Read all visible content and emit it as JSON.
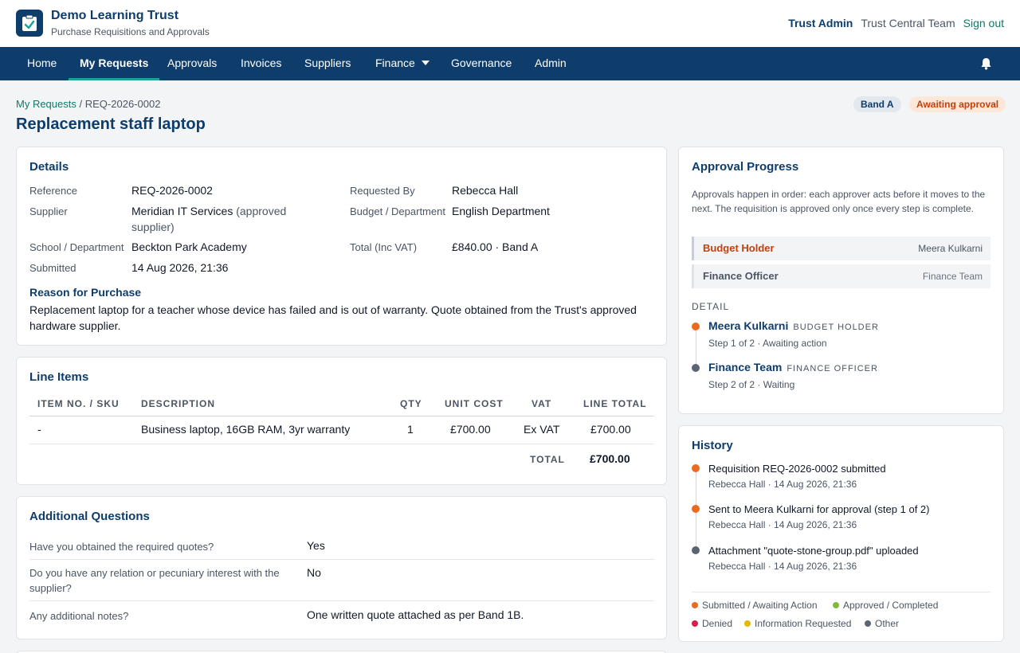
{
  "header": {
    "brand_title": "Demo Learning Trust",
    "brand_subtitle": "Purchase Requisitions and Approvals",
    "user_name": "Trust Admin",
    "user_team": "Trust Central Team",
    "sign_out": "Sign out"
  },
  "nav": {
    "items": [
      "Home",
      "My Requests",
      "Approvals",
      "Invoices",
      "Suppliers",
      "Finance",
      "Governance",
      "Admin"
    ],
    "active": "My Requests",
    "icons": [
      "bell-icon",
      "caret-down-icon"
    ]
  },
  "breadcrumb": {
    "parent": "My Requests",
    "separator": "/",
    "current": "REQ-2026-0002"
  },
  "page_title": "Replacement staff laptop",
  "badges": {
    "band": "Band A",
    "status": "Awaiting approval"
  },
  "colors": {
    "brand": "#0f3d6b",
    "accent": "#0f7a66",
    "orange": "#ea6a1f",
    "green": "#84b83a",
    "red": "#d61f4f",
    "yellow": "#e6b800",
    "grey": "#5b6472"
  },
  "details": {
    "title": "Details",
    "reference_label": "Reference",
    "reference": "REQ-2026-0002",
    "requested_by_label": "Requested By",
    "requested_by": "Rebecca Hall",
    "supplier_label": "Supplier",
    "supplier": "Meridian IT Services",
    "supplier_note": "(approved supplier)",
    "budget_label": "Budget / Department",
    "budget": "English Department",
    "school_label": "School / Department",
    "school": "Beckton Park Academy",
    "total_label": "Total (Inc VAT)",
    "total": "£840.00 · Band A",
    "submitted_label": "Submitted",
    "submitted": "14 Aug 2026, 21:36",
    "reason_title": "Reason for Purchase",
    "reason": "Replacement laptop for a teacher whose device has failed and is out of warranty. Quote obtained from the Trust's approved hardware supplier."
  },
  "line_items": {
    "title": "Line Items",
    "headers": [
      "ITEM NO. / SKU",
      "DESCRIPTION",
      "QTY",
      "UNIT COST",
      "VAT",
      "LINE TOTAL"
    ],
    "rows": [
      {
        "sku": "-",
        "description": "Business laptop, 16GB RAM, 3yr warranty",
        "qty": "1",
        "unit_cost": "£700.00",
        "vat": "Ex VAT",
        "line_total": "£700.00"
      }
    ],
    "total_label": "TOTAL",
    "total": "£700.00"
  },
  "questions": {
    "title": "Additional Questions",
    "items": [
      {
        "q": "Have you obtained the required quotes?",
        "a": "Yes"
      },
      {
        "q": "Do you have any relation or pecuniary interest with the supplier?",
        "a": "No"
      },
      {
        "q": "Any additional notes?",
        "a": "One written quote attached as per Band 1B."
      }
    ]
  },
  "approval": {
    "title": "Approval Progress",
    "intro": "Approvals happen in order: each approver acts before it moves to the next. The requisition is approved only once every step is complete.",
    "steps": [
      {
        "role": "Budget Holder",
        "person": "Meera Kulkarni"
      },
      {
        "role": "Finance Officer",
        "person": "Finance Team"
      }
    ],
    "detail_label": "DETAIL",
    "detail": [
      {
        "name": "Meera Kulkarni",
        "role": "BUDGET HOLDER",
        "status": "Step 1 of 2 · Awaiting action"
      },
      {
        "name": "Finance Team",
        "role": "FINANCE OFFICER",
        "status": "Step 2 of 2 · Waiting"
      }
    ]
  },
  "history": {
    "title": "History",
    "events": [
      {
        "text": "Requisition REQ-2026-0002 submitted",
        "meta": "Rebecca Hall · 14 Aug 2026, 21:36"
      },
      {
        "text": "Sent to Meera Kulkarni for approval (step 1 of 2)",
        "meta": "Rebecca Hall · 14 Aug 2026, 21:36"
      },
      {
        "text": "Attachment \"quote-stone-group.pdf\" uploaded",
        "meta": "Rebecca Hall · 14 Aug 2026, 21:36"
      }
    ],
    "legend": [
      "Submitted / Awaiting Action",
      "Approved / Completed",
      "Denied",
      "Information Requested",
      "Other"
    ]
  }
}
